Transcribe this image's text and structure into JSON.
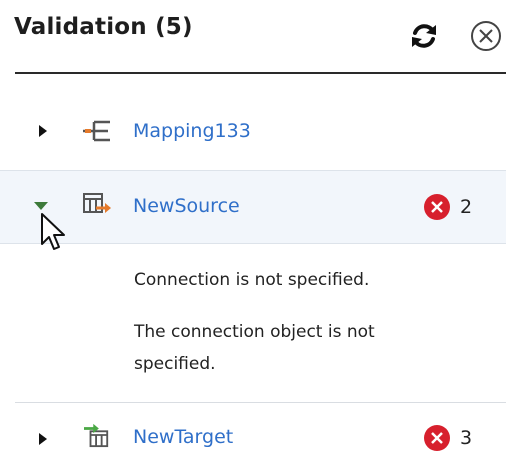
{
  "panel": {
    "title": "Validation (5)",
    "refresh_icon": "refresh-icon",
    "close_icon": "close-circle-icon"
  },
  "items": [
    {
      "label": "Mapping133",
      "icon": "mapping-icon",
      "expanded": false,
      "error_count": ""
    },
    {
      "label": "NewSource",
      "icon": "source-icon",
      "expanded": true,
      "error_count": "2",
      "messages": [
        "Connection is not specified.",
        "The connection object is not specified."
      ]
    },
    {
      "label": "NewTarget",
      "icon": "target-icon",
      "expanded": false,
      "error_count": "3"
    }
  ],
  "colors": {
    "link": "#2f6fc9",
    "error": "#d7202d",
    "expanded_caret": "#3d7a3a",
    "selected_bg": "#f2f6fb"
  }
}
